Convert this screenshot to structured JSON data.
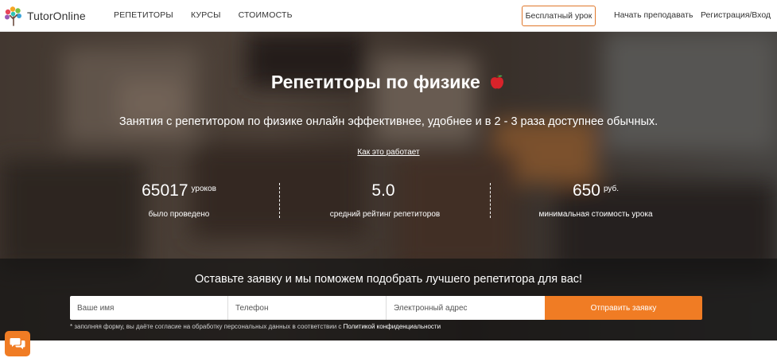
{
  "header": {
    "logo_text": "TutorOnline",
    "nav": [
      "РЕПЕТИТОРЫ",
      "КУРСЫ",
      "СТОИМОСТЬ"
    ],
    "free_lesson": "Бесплатный урок",
    "start_teaching": "Начать преподавать",
    "login": "Регистрация/Вход"
  },
  "hero": {
    "title": "Репетиторы по физике",
    "title_icon": "apple-icon",
    "subtitle": "Занятия с репетитором по физике онлайн эффективнее, удобнее и в 2 - 3 раза доступнее обычных.",
    "how_link": "Как это работает",
    "stats": [
      {
        "value": "65017",
        "unit": "уроков",
        "desc": "было проведено"
      },
      {
        "value": "5.0",
        "unit": "",
        "desc": "средний рейтинг репетиторов"
      },
      {
        "value": "650",
        "unit": "руб.",
        "desc": "минимальная стоимость урока"
      }
    ]
  },
  "form": {
    "heading": "Оставьте заявку и мы поможем подобрать лучшего репетитора для вас!",
    "name_placeholder": "Ваше имя",
    "phone_placeholder": "Телефон",
    "email_placeholder": "Электронный адрес",
    "submit": "Отправить заявку",
    "consent_text": "* заполняя форму, вы даёте согласие на обработку персональных данных в соответствии с",
    "policy_link": "Политикой конфиденциальности"
  },
  "chat": {
    "icon": "chat-icon"
  },
  "colors": {
    "accent": "#f07c24",
    "button_border": "#e0772a"
  }
}
